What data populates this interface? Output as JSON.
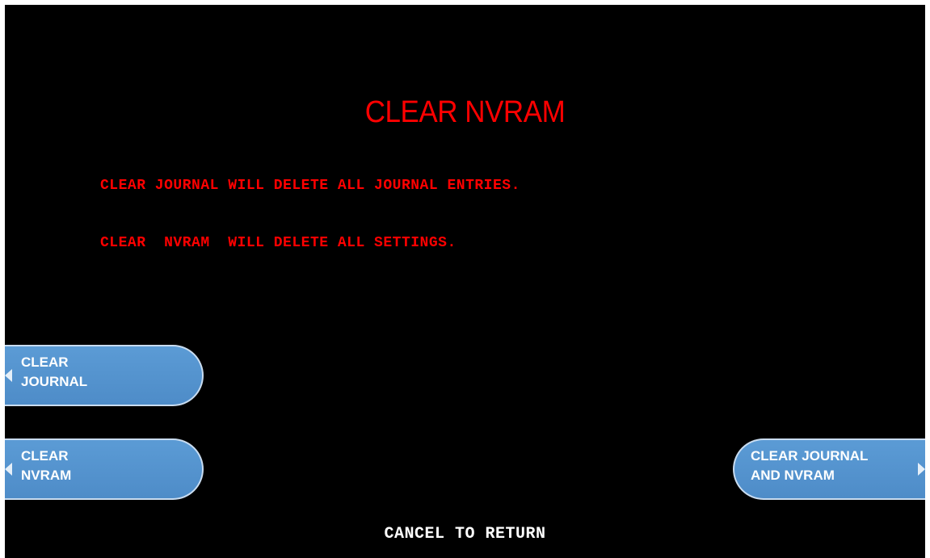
{
  "screen": {
    "title": "CLEAR NVRAM",
    "messages": [
      "CLEAR JOURNAL WILL DELETE ALL JOURNAL ENTRIES.",
      "CLEAR  NVRAM  WILL DELETE ALL SETTINGS."
    ],
    "footer": "CANCEL TO RETURN"
  },
  "buttons": {
    "clear_journal": "CLEAR\nJOURNAL",
    "clear_nvram": "CLEAR\nNVRAM",
    "clear_journal_and_nvram": "CLEAR JOURNAL\nAND NVRAM"
  },
  "colors": {
    "background": "#000000",
    "text_red": "#ff0000",
    "button_blue": "#5b9bd5",
    "footer_text": "#ffffff"
  }
}
